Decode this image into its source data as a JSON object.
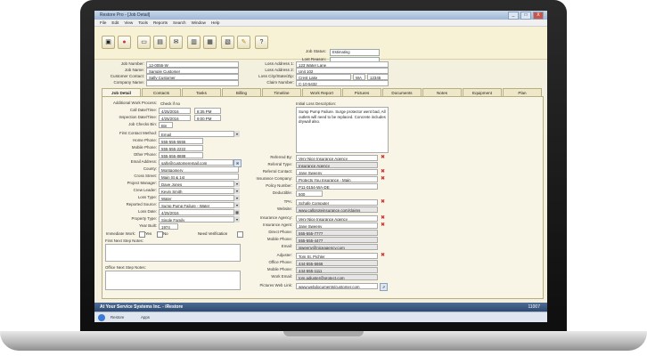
{
  "window": {
    "title": "Restore Pro - [Job Detail]",
    "controls": [
      "_",
      "□",
      "X"
    ]
  },
  "menu": [
    "File",
    "Edit",
    "View",
    "Tools",
    "Reports",
    "Search",
    "Window",
    "Help"
  ],
  "toolbar": {
    "status_label": "Job Status:",
    "status_value": "Estimating",
    "lost_reason_label": "Lost Reason:",
    "lost_reason_value": ""
  },
  "header": {
    "job_number": {
      "label": "Job Number:",
      "value": "12-0056-W"
    },
    "job_name": {
      "label": "Job Name:",
      "value": "Sample Customer"
    },
    "customer_contact": {
      "label": "Customer Contact:",
      "value": "Sally Customer"
    },
    "company_name": {
      "label": "Company Name:",
      "value": ""
    },
    "loss_address": {
      "label": "Loss Address 1:",
      "value": "123 Water Lane"
    },
    "loss_address2": {
      "label": "Loss Address 2:",
      "value": "Unit 102"
    },
    "loss_city": {
      "label": "Loss City/State/Zip:",
      "value": "Crest Lake",
      "state": "WA",
      "zip": "12345"
    },
    "claim_number": {
      "label": "Claim Number:",
      "value": "C-10-5432"
    }
  },
  "tabs": [
    "Job Detail",
    "Contacts",
    "Tasks",
    "Billing",
    "Timeline",
    "Work Report",
    "Pictures",
    "Documents",
    "Notes",
    "Equipment",
    "Plan"
  ],
  "left": {
    "received": {
      "label": "Additional Work Process:",
      "value": "Check if no"
    },
    "call_date": {
      "label": "Call Date/Time:",
      "date": "4/25/2016",
      "time": "8:35 PM"
    },
    "inspection_date": {
      "label": "Inspection Date/Time:",
      "date": "4/25/2016",
      "time": "9:00 PM"
    },
    "job_checks": {
      "label": "Job Checks Bin:",
      "value": "Bin"
    },
    "first_contact": {
      "label": "First Contact Method:",
      "value": "Email"
    },
    "home_phone": {
      "label": "Home Phone:",
      "value": "555-555-5555"
    },
    "mobile_phone": {
      "label": "Mobile Phone:",
      "value": "555-555-2222"
    },
    "other_phone": {
      "label": "Other Phone:",
      "value": "555-555-8888"
    },
    "email": {
      "label": "Email Address:",
      "value": "sally@customeremail.com"
    },
    "county": {
      "label": "County:",
      "value": "Montgomery"
    },
    "cross_street": {
      "label": "Cross Street:",
      "value": "Main St & 1st"
    },
    "project_manager": {
      "label": "Project Manager:",
      "value": "Dave Jones"
    },
    "crew_leader": {
      "label": "Crew Leader:",
      "value": "Kevin Smith"
    },
    "loss_type": {
      "label": "Loss Type:",
      "value": "Water"
    },
    "reported_source": {
      "label": "Reported Source:",
      "value": "Sump Pump Failure - Water"
    },
    "loss_date": {
      "label": "Loss Date:",
      "value": "4/25/2016"
    },
    "property_type": {
      "label": "Property Type:",
      "value": "Single Family"
    },
    "year_built": {
      "label": "Year Built:",
      "value": "1974"
    },
    "checks": {
      "label": "Immediate Work:",
      "yes": "Yes",
      "no": "No",
      "need_verify": "Need Verification"
    },
    "first_next_step": {
      "label": "First Next Step Notes:",
      "value": ""
    },
    "office_next_step": {
      "label": "Office Next Step Notes:",
      "value": ""
    }
  },
  "right": {
    "description_label": "Initial Loss Description:",
    "description": "Sump Pump Failure. Surge protector went bad, All outlets will need to be replaced. Concrete includes drywall also.",
    "referred_by": {
      "label": "Referred By:",
      "value": "Very Nice Insurance Agency"
    },
    "referral_type": {
      "label": "Referral Type:",
      "value": "Insurance Agency"
    },
    "referral_contact": {
      "label": "Referral Contact:",
      "value": "Jane Sweeny"
    },
    "insurance_company": {
      "label": "Insurance Company:",
      "value": "Protects You Insurance - Main"
    },
    "policy_number": {
      "label": "Policy Number:",
      "value": "P11-0154-WA-DE"
    },
    "deductible": {
      "label": "Deductible:",
      "value": "500"
    },
    "tpa": {
      "label": "TPA:",
      "value": "Schafe Computer"
    },
    "website": {
      "label": "Website:",
      "value": "www.callproteinsurance.com/claims"
    },
    "insurance_agency": {
      "label": "Insurance Agency:",
      "value": "Very Nice Insurance Agency"
    },
    "insurance_agent": {
      "label": "Insurance Agent:",
      "value": "Jane Sweeny"
    },
    "direct_phone": {
      "label": "Direct Phone:",
      "value": "555-555-7777"
    },
    "mobile_phone": {
      "label": "Mobile Phone:",
      "value": "555-555-4477"
    },
    "email": {
      "label": "Email:",
      "value": "jsweeny@niceagency.com"
    },
    "adjuster": {
      "label": "Adjuster:",
      "value": "Tom St. Pichler"
    },
    "office_phone": {
      "label": "Office Phone:",
      "value": "444-555-6666"
    },
    "mobile_phone2": {
      "label": "Mobile Phone:",
      "value": "444-555-1111"
    },
    "work_email": {
      "label": "Work Email:",
      "value": "tom.adjuster@protect.com"
    },
    "pictures_web": {
      "label": "Pictures Web Link:",
      "value": "www.webdocuments/customer.com"
    }
  },
  "statusbar": {
    "left": "At Your Service Systems Inc. - iRestore",
    "right": "11007"
  },
  "taskbar": {
    "app1": "Restore",
    "app2": "Apps"
  }
}
